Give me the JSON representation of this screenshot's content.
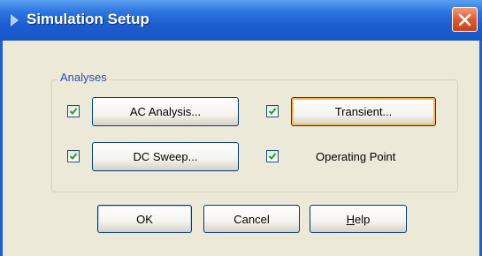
{
  "window": {
    "title": "Simulation Setup"
  },
  "analyses": {
    "group_label": "Analyses",
    "items": [
      {
        "label": "AC Analysis...",
        "checked": true
      },
      {
        "label": "Transient...",
        "checked": true
      },
      {
        "label": "DC Sweep...",
        "checked": true
      },
      {
        "label": "Operating Point",
        "checked": true
      }
    ]
  },
  "footer": {
    "ok_label": "OK",
    "cancel_label": "Cancel",
    "help_label": "Help",
    "help_accelerator": "H"
  },
  "colors": {
    "titlebar": "#1d5ed2",
    "client_bg": "#ece9d8",
    "checkmark": "#21a121",
    "group_label": "#2b4fae",
    "close_button": "#e25a2c"
  }
}
